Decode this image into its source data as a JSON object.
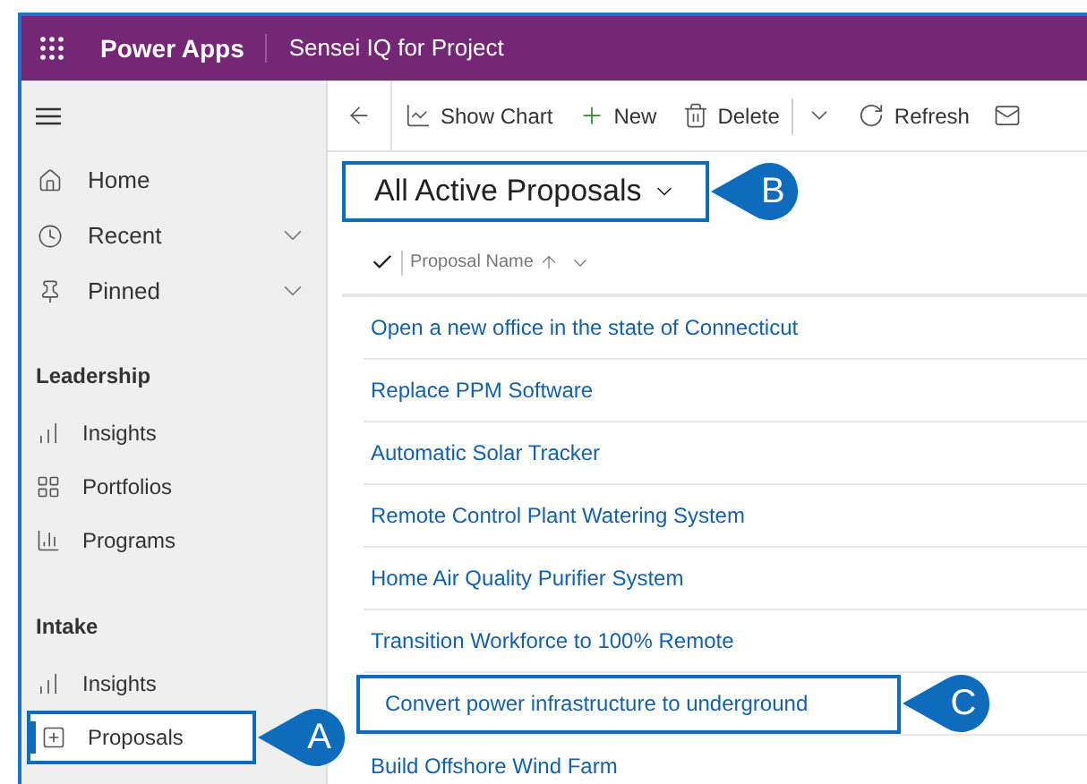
{
  "app": {
    "title": "Power Apps",
    "environment": "Sensei IQ for Project"
  },
  "toolbar": [
    {
      "kind": "icon"
    },
    {
      "kind": "button",
      "label": "Show Chart"
    },
    {
      "kind": "button",
      "label": "New"
    },
    {
      "kind": "button",
      "label": "Delete"
    },
    {
      "kind": "icon"
    },
    {
      "kind": "button",
      "label": "Refresh"
    },
    {
      "kind": "icon"
    }
  ],
  "sidebar": {
    "top": [
      {
        "label": "Home",
        "expandable": false
      },
      {
        "label": "Recent",
        "expandable": true
      },
      {
        "label": "Pinned",
        "expandable": true
      }
    ],
    "sections": [
      {
        "title": "Leadership",
        "items": [
          {
            "label": "Insights",
            "selected": false,
            "highlighted": false
          },
          {
            "label": "Portfolios",
            "selected": false,
            "highlighted": false
          },
          {
            "label": "Programs",
            "selected": false,
            "highlighted": false
          }
        ]
      },
      {
        "title": "Intake",
        "items": [
          {
            "label": "Insights",
            "selected": false,
            "highlighted": false
          },
          {
            "label": "Proposals",
            "selected": true,
            "highlighted": true,
            "callout": "A"
          }
        ]
      }
    ]
  },
  "view": {
    "title": "All Active Proposals",
    "highlighted": true,
    "callout": "B"
  },
  "grid": {
    "column": "Proposal Name",
    "rows": [
      {
        "name": "Open a new office in the state of Connecticut",
        "highlighted": false
      },
      {
        "name": "Replace PPM Software",
        "highlighted": false
      },
      {
        "name": "Automatic Solar Tracker",
        "highlighted": false
      },
      {
        "name": "Remote Control Plant Watering System",
        "highlighted": false
      },
      {
        "name": "Home Air Quality Purifier System",
        "highlighted": false
      },
      {
        "name": "Transition Workforce to 100% Remote",
        "highlighted": false
      },
      {
        "name": "Convert power infrastructure to underground",
        "highlighted": true,
        "callout": "C"
      },
      {
        "name": "Build Offshore Wind Farm",
        "highlighted": false
      }
    ]
  }
}
